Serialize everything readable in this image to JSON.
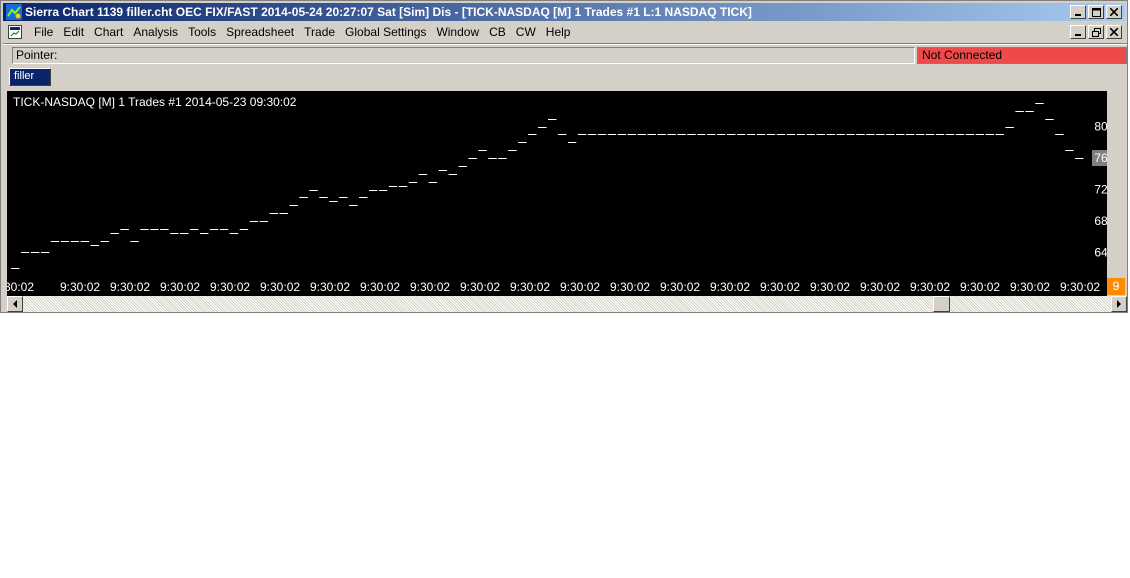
{
  "window": {
    "title": "Sierra Chart 1139 filler.cht  OEC FIX/FAST 2014-05-24  20:27:07 Sat [Sim]  Dis - [TICK-NASDAQ [M]  1 Trades  #1  L:1  NASDAQ TICK]"
  },
  "menu": {
    "items": [
      "File",
      "Edit",
      "Chart",
      "Analysis",
      "Tools",
      "Spreadsheet",
      "Trade",
      "Global Settings",
      "Window",
      "CB",
      "CW",
      "Help"
    ]
  },
  "status": {
    "pointer_label": "Pointer:",
    "connection": "Not Connected",
    "connection_color": "#ef4a4a"
  },
  "tabs": [
    {
      "label": "filler"
    }
  ],
  "chart": {
    "header": "TICK-NASDAQ [M]  1 Trades  #1 2014-05-23 09:30:02",
    "current_value_label": "76",
    "corner_label": "9"
  },
  "chart_data": {
    "type": "line",
    "style": "dash-per-bar (horizontal ticks)",
    "title": "TICK-NASDAQ [M]  1 Trades  #1 2014-05-23 09:30:02",
    "y_ticks": [
      64,
      68,
      72,
      76,
      80
    ],
    "ylim": [
      61,
      83
    ],
    "x_tick_labels": [
      "30:02",
      "9:30:02",
      "9:30:02",
      "9:30:02",
      "9:30:02",
      "9:30:02",
      "9:30:02",
      "9:30:02",
      "9:30:02",
      "9:30:02",
      "9:30:02",
      "9:30:02",
      "9:30:02",
      "9:30:02",
      "9:30:02",
      "9:30:02",
      "9:30:02",
      "9:30:02",
      "9:30:02",
      "9:30:02",
      "9:30:02",
      "9:30:02"
    ],
    "values": [
      62,
      64,
      64,
      64,
      65.5,
      65.5,
      65.5,
      65.5,
      65,
      65.5,
      66.5,
      67,
      65.5,
      67,
      67,
      67,
      66.5,
      66.5,
      67,
      66.5,
      67,
      67,
      66.5,
      67,
      68,
      68,
      69,
      69,
      70,
      71,
      72,
      71,
      70.5,
      71,
      70,
      71,
      72,
      72,
      72.5,
      72.5,
      73,
      74,
      73,
      74.5,
      74,
      75,
      76,
      77,
      76,
      76,
      77,
      78,
      79,
      80,
      81,
      79,
      78,
      79,
      79,
      79,
      79,
      79,
      79,
      79,
      79,
      79,
      79,
      79,
      79,
      79,
      79,
      79,
      79,
      79,
      79,
      79,
      79,
      79,
      79,
      79,
      79,
      79,
      79,
      79,
      79,
      79,
      79,
      79,
      79,
      79,
      79,
      79,
      79,
      79,
      79,
      79,
      79,
      79,
      79,
      79,
      80,
      82,
      82,
      83,
      81,
      79,
      77,
      76
    ],
    "grid": false,
    "background": "#000000",
    "line_color": "#ffffff",
    "axis_text_color": "#ffffff"
  }
}
